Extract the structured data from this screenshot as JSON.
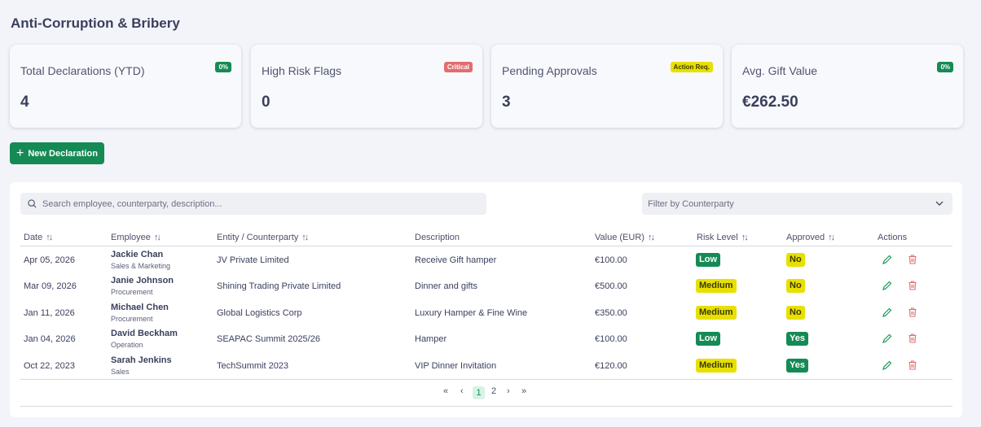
{
  "page": {
    "title": "Anti-Corruption & Bribery"
  },
  "cards": [
    {
      "label": "Total Declarations (YTD)",
      "value": "4",
      "badge": "0%",
      "badge_color": "#168a55"
    },
    {
      "label": "High Risk Flags",
      "value": "0",
      "badge": "Critical",
      "badge_color": "#e26d6d"
    },
    {
      "label": "Pending Approvals",
      "value": "3",
      "badge": "Action Req.",
      "badge_color": "#e8e000"
    },
    {
      "label": "Avg. Gift Value",
      "value": "€262.50",
      "badge": "0%",
      "badge_color": "#168a55"
    }
  ],
  "toolbar": {
    "new_label": "New Declaration"
  },
  "search": {
    "placeholder": "Search employee, counterparty, description..."
  },
  "filter": {
    "placeholder": "Filter by Counterparty"
  },
  "table": {
    "headers": {
      "date": "Date",
      "employee": "Employee",
      "entity": "Entity / Counterparty",
      "description": "Description",
      "value": "Value (EUR)",
      "risk": "Risk Level",
      "approved": "Approved",
      "actions": "Actions"
    },
    "rows": [
      {
        "date": "Apr 05, 2026",
        "name": "Jackie Chan",
        "dept": "Sales & Marketing",
        "entity": "JV Private Limited",
        "description": "Receive Gift hamper",
        "value": "€100.00",
        "risk": "Low",
        "approved": "No"
      },
      {
        "date": "Mar 09, 2026",
        "name": "Janie Johnson",
        "dept": "Procurement",
        "entity": "Shining Trading Private Limited",
        "description": "Dinner and gifts",
        "value": "€500.00",
        "risk": "Medium",
        "approved": "No"
      },
      {
        "date": "Jan 11, 2026",
        "name": "Michael Chen",
        "dept": "Procurement",
        "entity": "Global Logistics Corp",
        "description": "Luxury Hamper & Fine Wine",
        "value": "€350.00",
        "risk": "Medium",
        "approved": "No"
      },
      {
        "date": "Jan 04, 2026",
        "name": "David Beckham",
        "dept": "Operation",
        "entity": "SEAPAC Summit 2025/26",
        "description": "Hamper",
        "value": "€100.00",
        "risk": "Low",
        "approved": "Yes"
      },
      {
        "date": "Oct 22, 2023",
        "name": "Sarah Jenkins",
        "dept": "Sales",
        "entity": "TechSummit 2023",
        "description": "VIP Dinner Invitation",
        "value": "€120.00",
        "risk": "Medium",
        "approved": "Yes"
      }
    ]
  },
  "pagination": {
    "first": "«",
    "prev": "‹",
    "pages": [
      "1",
      "2"
    ],
    "current": "1",
    "next": "›",
    "last": "»"
  },
  "colors": {
    "accent": "#168a55",
    "danger": "#e26d6d",
    "warning": "#e8e000"
  },
  "icons": {
    "search": "search-icon",
    "chevron": "chevron-down-icon",
    "edit": "pencil-icon",
    "delete": "trash-icon",
    "add": "plus-icon"
  }
}
